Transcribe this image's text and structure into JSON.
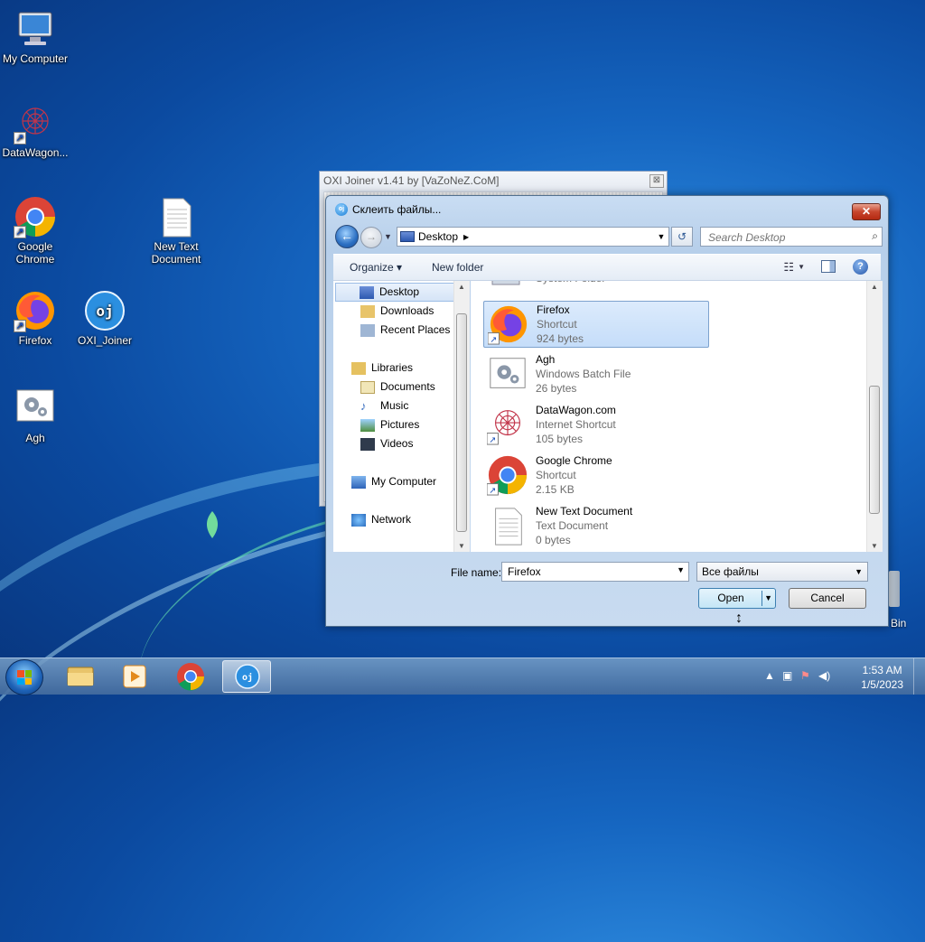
{
  "desktop": {
    "icons": [
      {
        "label": "My Computer"
      },
      {
        "label": "DataWagon..."
      },
      {
        "label": "Google Chrome"
      },
      {
        "label": "New Text Document"
      },
      {
        "label": "Firefox"
      },
      {
        "label": "OXI_Joiner"
      },
      {
        "label": "Agh"
      }
    ],
    "recycle_bin_partial": "Bin"
  },
  "oxi_window": {
    "title": "OXI Joiner v1.41 by [VaZoNeZ.CoM]",
    "close": "⊠"
  },
  "dialog": {
    "title": "Склеить файлы...",
    "close": "✕",
    "address": {
      "location": "Desktop"
    },
    "search_placeholder": "Search Desktop",
    "toolbar": {
      "organize": "Organize ▾",
      "new_folder": "New folder"
    },
    "nav": {
      "desktop": "Desktop",
      "downloads": "Downloads",
      "recent_places": "Recent Places",
      "libraries": "Libraries",
      "documents": "Documents",
      "music": "Music",
      "pictures": "Pictures",
      "videos": "Videos",
      "my_computer": "My Computer",
      "network": "Network"
    },
    "files": [
      {
        "name": "",
        "type": "System Folder",
        "size": ""
      },
      {
        "name": "Firefox",
        "type": "Shortcut",
        "size": "924 bytes"
      },
      {
        "name": "Agh",
        "type": "Windows Batch File",
        "size": "26 bytes"
      },
      {
        "name": "DataWagon.com",
        "type": "Internet Shortcut",
        "size": "105 bytes"
      },
      {
        "name": "Google Chrome",
        "type": "Shortcut",
        "size": "2.15 KB"
      },
      {
        "name": "New Text Document",
        "type": "Text Document",
        "size": "0 bytes"
      }
    ],
    "file_name_label": "File name:",
    "file_name_value": "Firefox",
    "file_type": "Все файлы",
    "open_button": "Open",
    "cancel_button": "Cancel"
  },
  "taskbar": {
    "clock_time": "1:53 AM",
    "clock_date": "1/5/2023"
  },
  "colors": {
    "accent": "#1565c0",
    "selection": "#c5ddf9"
  }
}
